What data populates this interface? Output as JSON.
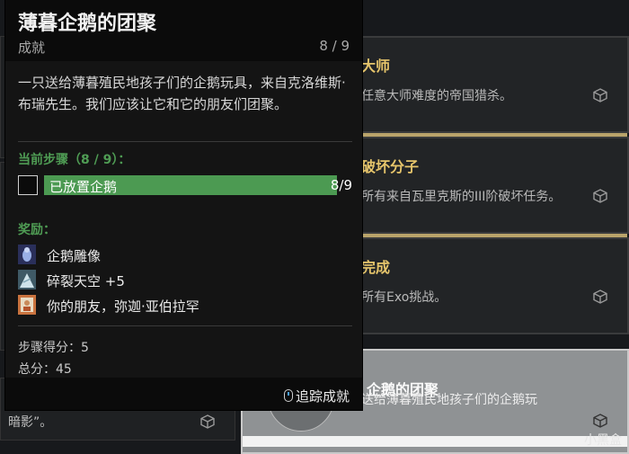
{
  "tooltip": {
    "title": "薄暮企鹅的团聚",
    "subtitle": "成就",
    "progress": "8 / 9",
    "description": "一只送给薄暮殖民地孩子们的企鹅玩具，来自克洛维斯·布瑞先生。我们应该让它和它的朋友们团聚。",
    "current_step_label": "当前步骤（8 / 9）：",
    "step": {
      "label": "已放置企鹅",
      "value": "8/9",
      "fill": 0.92
    },
    "rewards_label": "奖励：",
    "rewards": [
      {
        "icon": "penguin-statue-icon",
        "text": "企鹅雕像"
      },
      {
        "icon": "shattered-sky-icon",
        "text": "碎裂天空  +5"
      },
      {
        "icon": "portrait-icon",
        "text": "你的朋友，弥迦·亚伯拉罕"
      }
    ],
    "step_score": "步骤得分：5",
    "total_score": "总分：45",
    "track": "追踪成就"
  },
  "cards": [
    {
      "title": "大师",
      "desc": "任意大师难度的帝国猎杀。",
      "icon": "cube-icon"
    },
    {
      "title": "破坏分子",
      "desc": "所有来自瓦里克斯的III阶破坏任务。",
      "icon": "cube-icon"
    },
    {
      "title": "完成",
      "desc": "所有Exo挑战。",
      "icon": "cube-icon"
    },
    {
      "title": "企鹅的团聚",
      "desc": "一只送给薄暮殖民地孩子们的企鹅玩",
      "icon": "cube-icon"
    }
  ],
  "left_card": {
    "text": "暗影”。",
    "icon": "cube-icon"
  },
  "watermark": "小黑盒",
  "colors": {
    "gold": "#e6c56b",
    "green": "#4c9a52",
    "divider": "#b9a36a"
  }
}
